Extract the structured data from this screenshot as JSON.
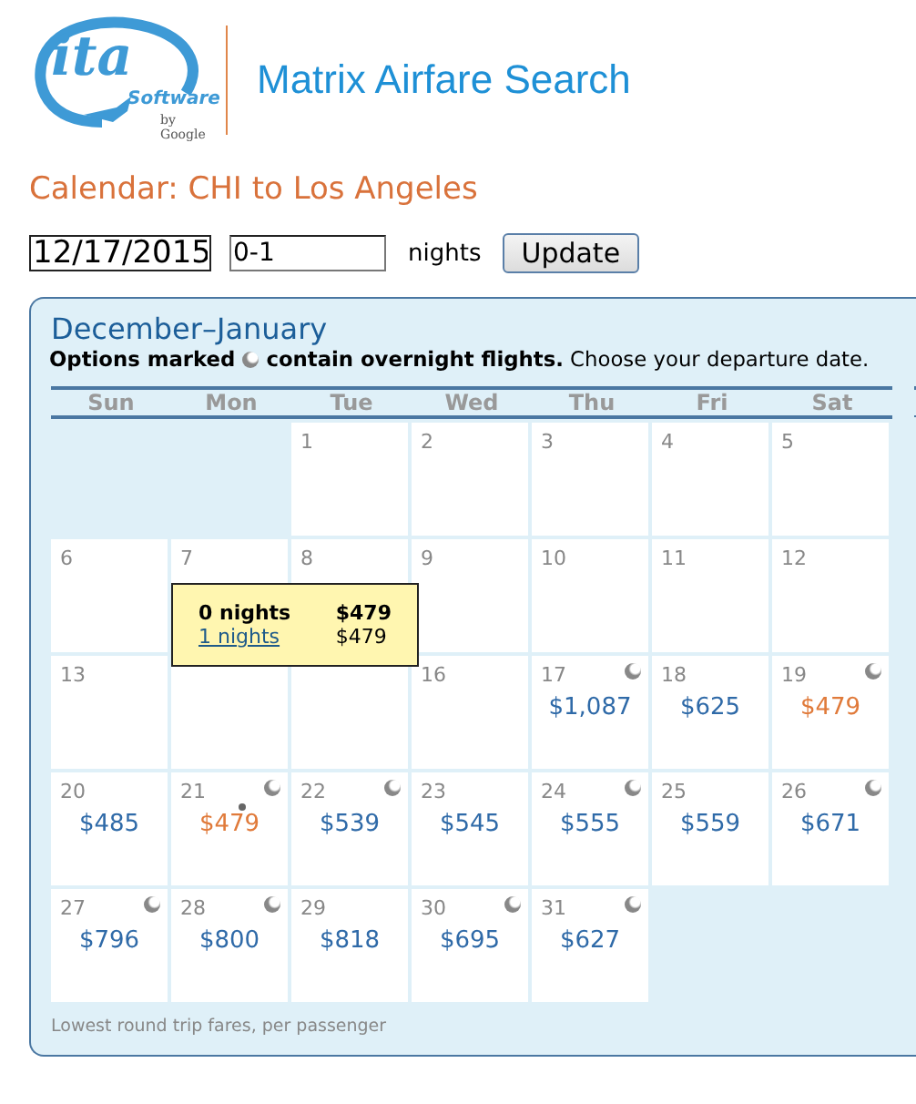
{
  "logo": {
    "mark": "ita",
    "word": "Software",
    "by": "by Google"
  },
  "app_title": "Matrix Airfare Search",
  "page_title": "Calendar: CHI to Los Angeles",
  "form": {
    "date": "12/17/2015",
    "nights": "0-1",
    "nights_label": "nights",
    "button": "Update"
  },
  "calendar": {
    "title": "December–January",
    "legend_before": "Options marked",
    "legend_after": "**contain overnight flights.** Choose your departure date.",
    "weekdays": [
      "Sun",
      "Mon",
      "Tue",
      "Wed",
      "Thu",
      "Fri",
      "Sat"
    ],
    "cells": [
      {
        "kind": "blank"
      },
      {
        "kind": "blank"
      },
      {
        "kind": "nofare",
        "day": "1"
      },
      {
        "kind": "nofare",
        "day": "2"
      },
      {
        "kind": "nofare",
        "day": "3"
      },
      {
        "kind": "nofare",
        "day": "4"
      },
      {
        "kind": "nofare",
        "day": "5"
      },
      {
        "kind": "nofare",
        "day": "6"
      },
      {
        "kind": "nofare",
        "day": "7"
      },
      {
        "kind": "nofare",
        "day": "8"
      },
      {
        "kind": "nofare",
        "day": "9"
      },
      {
        "kind": "nofare",
        "day": "10"
      },
      {
        "kind": "nofare",
        "day": "11"
      },
      {
        "kind": "nofare",
        "day": "12"
      },
      {
        "kind": "nofare",
        "day": "13"
      },
      {
        "kind": "covered"
      },
      {
        "kind": "covered"
      },
      {
        "kind": "nofare",
        "day": "16"
      },
      {
        "kind": "day",
        "day": "17",
        "price": "$1,087",
        "overnight": true,
        "lowest": false,
        "selected": false
      },
      {
        "kind": "day",
        "day": "18",
        "price": "$625",
        "overnight": false,
        "lowest": false,
        "selected": false
      },
      {
        "kind": "day",
        "day": "19",
        "price": "$479",
        "overnight": true,
        "lowest": true,
        "selected": false
      },
      {
        "kind": "day",
        "day": "20",
        "price": "$485",
        "overnight": false,
        "lowest": false,
        "selected": false
      },
      {
        "kind": "day",
        "day": "21",
        "price": "$479",
        "overnight": true,
        "lowest": true,
        "selected": true
      },
      {
        "kind": "day",
        "day": "22",
        "price": "$539",
        "overnight": true,
        "lowest": false,
        "selected": false
      },
      {
        "kind": "day",
        "day": "23",
        "price": "$545",
        "overnight": false,
        "lowest": false,
        "selected": false
      },
      {
        "kind": "day",
        "day": "24",
        "price": "$555",
        "overnight": true,
        "lowest": false,
        "selected": false
      },
      {
        "kind": "day",
        "day": "25",
        "price": "$559",
        "overnight": false,
        "lowest": false,
        "selected": false
      },
      {
        "kind": "day",
        "day": "26",
        "price": "$671",
        "overnight": true,
        "lowest": false,
        "selected": false
      },
      {
        "kind": "day",
        "day": "27",
        "price": "$796",
        "overnight": true,
        "lowest": false,
        "selected": false
      },
      {
        "kind": "day",
        "day": "28",
        "price": "$800",
        "overnight": true,
        "lowest": false,
        "selected": false
      },
      {
        "kind": "day",
        "day": "29",
        "price": "$818",
        "overnight": false,
        "lowest": false,
        "selected": false
      },
      {
        "kind": "day",
        "day": "30",
        "price": "$695",
        "overnight": true,
        "lowest": false,
        "selected": false
      },
      {
        "kind": "day",
        "day": "31",
        "price": "$627",
        "overnight": true,
        "lowest": false,
        "selected": false
      },
      {
        "kind": "blank"
      },
      {
        "kind": "blank"
      }
    ],
    "tooltip": [
      {
        "kind": "current",
        "nights": "0 nights",
        "price": "$479"
      },
      {
        "kind": "link",
        "nights": "1 nights",
        "price": "$479"
      }
    ],
    "footnote": "Lowest round trip fares, per passenger"
  }
}
